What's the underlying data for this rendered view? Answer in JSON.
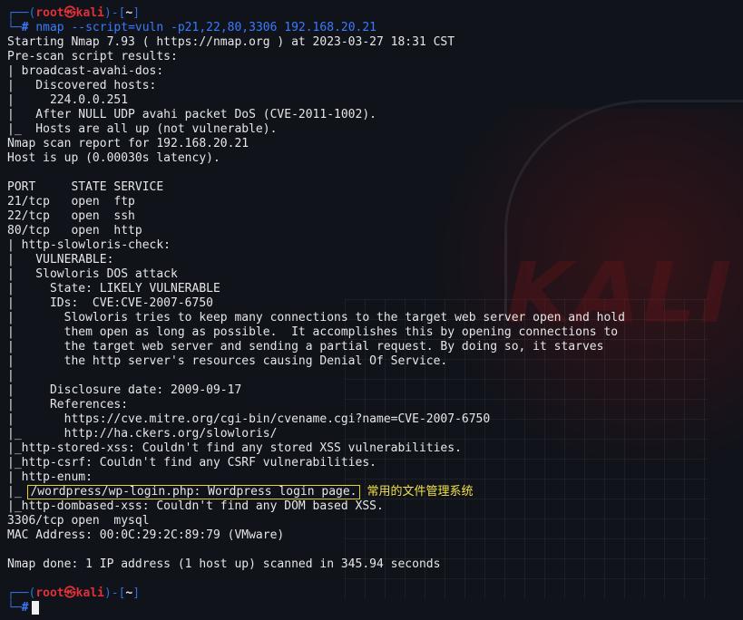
{
  "prompt": {
    "corner_top": "┌──(",
    "user": "root㉿kali",
    "mid": ")-[",
    "path": "~",
    "end": "]",
    "corner_bottom": "└─",
    "hash": "#"
  },
  "command": {
    "name": "nmap",
    "args": "--script=vuln -p21,22,80,3306 192.168.20.21"
  },
  "output": [
    "Starting Nmap 7.93 ( https://nmap.org ) at 2023-03-27 18:31 CST",
    "Pre-scan script results:",
    "| broadcast-avahi-dos:",
    "|   Discovered hosts:",
    "|     224.0.0.251",
    "|   After NULL UDP avahi packet DoS (CVE-2011-1002).",
    "|_  Hosts are all up (not vulnerable).",
    "Nmap scan report for 192.168.20.21",
    "Host is up (0.00030s latency).",
    "",
    "PORT     STATE SERVICE",
    "21/tcp   open  ftp",
    "22/tcp   open  ssh",
    "80/tcp   open  http",
    "| http-slowloris-check:",
    "|   VULNERABLE:",
    "|   Slowloris DOS attack",
    "|     State: LIKELY VULNERABLE",
    "|     IDs:  CVE:CVE-2007-6750",
    "|       Slowloris tries to keep many connections to the target web server open and hold",
    "|       them open as long as possible.  It accomplishes this by opening connections to",
    "|       the target web server and sending a partial request. By doing so, it starves",
    "|       the http server's resources causing Denial Of Service.",
    "|",
    "|     Disclosure date: 2009-09-17",
    "|     References:",
    "|       https://cve.mitre.org/cgi-bin/cvename.cgi?name=CVE-2007-6750",
    "|_      http://ha.ckers.org/slowloris/",
    "|_http-stored-xss: Couldn't find any stored XSS vulnerabilities.",
    "|_http-csrf: Couldn't find any CSRF vulnerabilities.",
    "| http-enum:"
  ],
  "highlight": {
    "prefix": "|_ ",
    "text": "/wordpress/wp-login.php: Wordpress login page.",
    "annotation": "常用的文件管理系统"
  },
  "output_after": [
    "|_http-dombased-xss: Couldn't find any DOM based XSS.",
    "3306/tcp open  mysql",
    "MAC Address: 00:0C:29:2C:89:79 (VMware)",
    "",
    "Nmap done: 1 IP address (1 host up) scanned in 345.94 seconds",
    ""
  ],
  "background": {
    "logo_text": "KALI"
  }
}
